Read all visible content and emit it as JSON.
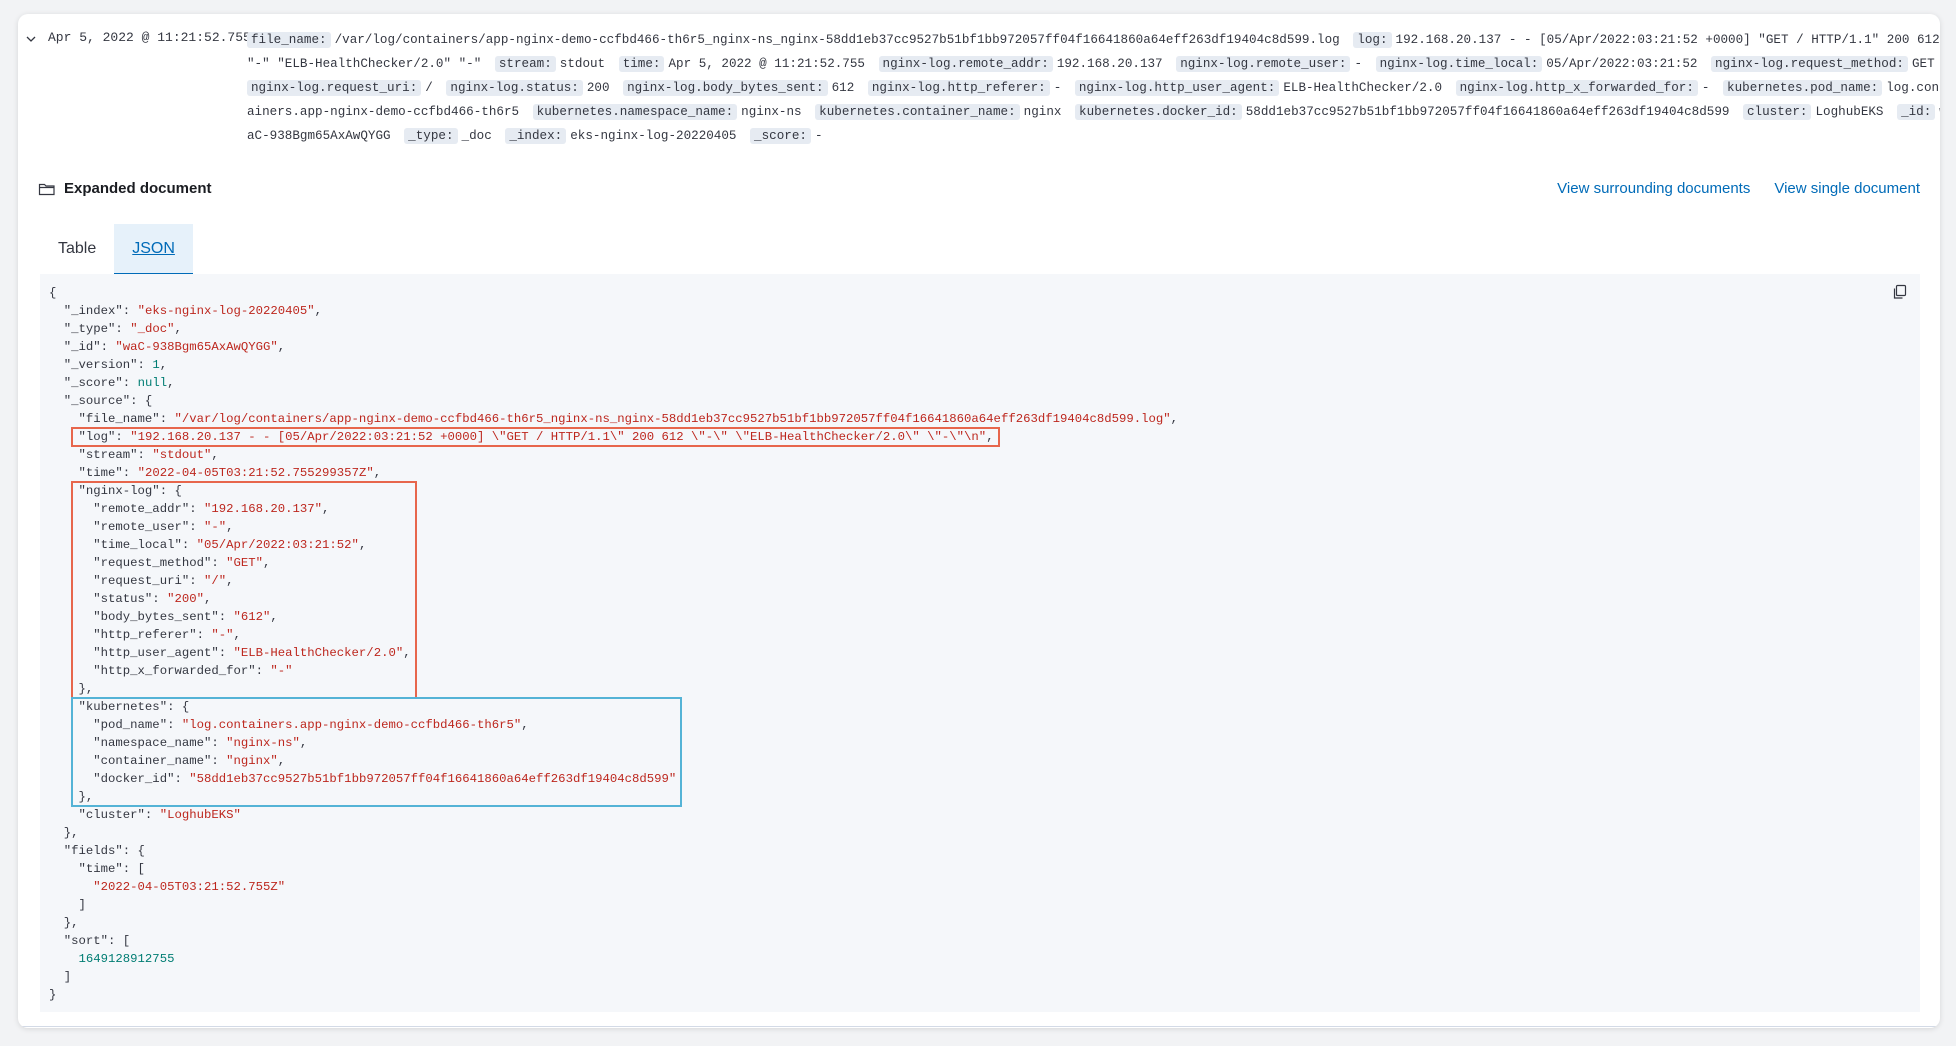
{
  "row": {
    "timestamp": "Apr 5, 2022 @ 11:21:52.755",
    "fields": [
      {
        "name": "file_name:",
        "value": "/var/log/containers/app-nginx-demo-ccfbd466-th6r5_nginx-ns_nginx-58dd1eb37cc9527b51bf1bb972057ff04f16641860a64eff263df19404c8d599.log"
      },
      {
        "name": "log:",
        "value": "192.168.20.137 - - [05/Apr/2022:03:21:52 +0000] \"GET / HTTP/1.1\" 200 612 \"-\" \"ELB-HealthChecker/2.0\" \"-\""
      },
      {
        "name": "stream:",
        "value": "stdout"
      },
      {
        "name": "time:",
        "value": "Apr 5, 2022 @ 11:21:52.755"
      },
      {
        "name": "nginx-log.remote_addr:",
        "value": "192.168.20.137"
      },
      {
        "name": "nginx-log.remote_user:",
        "value": "-"
      },
      {
        "name": "nginx-log.time_local:",
        "value": "05/Apr/2022:03:21:52"
      },
      {
        "name": "nginx-log.request_method:",
        "value": "GET"
      },
      {
        "name": "nginx-log.request_uri:",
        "value": "/"
      },
      {
        "name": "nginx-log.status:",
        "value": "200"
      },
      {
        "name": "nginx-log.body_bytes_sent:",
        "value": "612"
      },
      {
        "name": "nginx-log.http_referer:",
        "value": "-"
      },
      {
        "name": "nginx-log.http_user_agent:",
        "value": "ELB-HealthChecker/2.0"
      },
      {
        "name": "nginx-log.http_x_forwarded_for:",
        "value": "-"
      },
      {
        "name": "kubernetes.pod_name:",
        "value": "log.containers.app-nginx-demo-ccfbd466-th6r5"
      },
      {
        "name": "kubernetes.namespace_name:",
        "value": "nginx-ns"
      },
      {
        "name": "kubernetes.container_name:",
        "value": "nginx"
      },
      {
        "name": "kubernetes.docker_id:",
        "value": "58dd1eb37cc9527b51bf1bb972057ff04f16641860a64eff263df19404c8d599"
      },
      {
        "name": "cluster:",
        "value": "LoghubEKS"
      },
      {
        "name": "_id:",
        "value": "waC-938Bgm65AxAwQYGG"
      },
      {
        "name": "_type:",
        "value": "_doc"
      },
      {
        "name": "_index:",
        "value": "eks-nginx-log-20220405"
      },
      {
        "name": "_score:",
        "value": "-"
      }
    ]
  },
  "expanded": {
    "title": "Expanded document",
    "view_surrounding": "View surrounding documents",
    "view_single": "View single document",
    "tabs": [
      "Table",
      "JSON"
    ],
    "active_tab": "JSON"
  },
  "json_lines": [
    [
      [
        "p",
        "{"
      ]
    ],
    [
      [
        "k",
        "  \"_index\": "
      ],
      [
        "s",
        "\"eks-nginx-log-20220405\""
      ],
      [
        "p",
        ","
      ]
    ],
    [
      [
        "k",
        "  \"_type\": "
      ],
      [
        "s",
        "\"_doc\""
      ],
      [
        "p",
        ","
      ]
    ],
    [
      [
        "k",
        "  \"_id\": "
      ],
      [
        "s",
        "\"waC-938Bgm65AxAwQYGG\""
      ],
      [
        "p",
        ","
      ]
    ],
    [
      [
        "k",
        "  \"_version\": "
      ],
      [
        "n",
        "1"
      ],
      [
        "p",
        ","
      ]
    ],
    [
      [
        "k",
        "  \"_score\": "
      ],
      [
        "n",
        "null"
      ],
      [
        "p",
        ","
      ]
    ],
    [
      [
        "k",
        "  \"_source\": {"
      ]
    ],
    [
      [
        "k",
        "    \"file_name\": "
      ],
      [
        "s",
        "\"/var/log/containers/app-nginx-demo-ccfbd466-th6r5_nginx-ns_nginx-58dd1eb37cc9527b51bf1bb972057ff04f16641860a64eff263df19404c8d599.log\""
      ],
      [
        "p",
        ","
      ]
    ],
    [
      [
        "k",
        "    \"log\": "
      ],
      [
        "s",
        "\"192.168.20.137 - - [05/Apr/2022:03:21:52 +0000] \\\"GET / HTTP/1.1\\\" 200 612 \\\"-\\\" \\\"ELB-HealthChecker/2.0\\\" \\\"-\\\"\\n\""
      ],
      [
        "p",
        ","
      ]
    ],
    [
      [
        "k",
        "    \"stream\": "
      ],
      [
        "s",
        "\"stdout\""
      ],
      [
        "p",
        ","
      ]
    ],
    [
      [
        "k",
        "    \"time\": "
      ],
      [
        "s",
        "\"2022-04-05T03:21:52.755299357Z\""
      ],
      [
        "p",
        ","
      ]
    ],
    [
      [
        "k",
        "    \"nginx-log\": {"
      ]
    ],
    [
      [
        "k",
        "      \"remote_addr\": "
      ],
      [
        "s",
        "\"192.168.20.137\""
      ],
      [
        "p",
        ","
      ]
    ],
    [
      [
        "k",
        "      \"remote_user\": "
      ],
      [
        "s",
        "\"-\""
      ],
      [
        "p",
        ","
      ]
    ],
    [
      [
        "k",
        "      \"time_local\": "
      ],
      [
        "s",
        "\"05/Apr/2022:03:21:52\""
      ],
      [
        "p",
        ","
      ]
    ],
    [
      [
        "k",
        "      \"request_method\": "
      ],
      [
        "s",
        "\"GET\""
      ],
      [
        "p",
        ","
      ]
    ],
    [
      [
        "k",
        "      \"request_uri\": "
      ],
      [
        "s",
        "\"/\""
      ],
      [
        "p",
        ","
      ]
    ],
    [
      [
        "k",
        "      \"status\": "
      ],
      [
        "s",
        "\"200\""
      ],
      [
        "p",
        ","
      ]
    ],
    [
      [
        "k",
        "      \"body_bytes_sent\": "
      ],
      [
        "s",
        "\"612\""
      ],
      [
        "p",
        ","
      ]
    ],
    [
      [
        "k",
        "      \"http_referer\": "
      ],
      [
        "s",
        "\"-\""
      ],
      [
        "p",
        ","
      ]
    ],
    [
      [
        "k",
        "      \"http_user_agent\": "
      ],
      [
        "s",
        "\"ELB-HealthChecker/2.0\""
      ],
      [
        "p",
        ","
      ]
    ],
    [
      [
        "k",
        "      \"http_x_forwarded_for\": "
      ],
      [
        "s",
        "\"-\""
      ]
    ],
    [
      [
        "k",
        "    },"
      ]
    ],
    [
      [
        "k",
        "    \"kubernetes\": {"
      ]
    ],
    [
      [
        "k",
        "      \"pod_name\": "
      ],
      [
        "s",
        "\"log.containers.app-nginx-demo-ccfbd466-th6r5\""
      ],
      [
        "p",
        ","
      ]
    ],
    [
      [
        "k",
        "      \"namespace_name\": "
      ],
      [
        "s",
        "\"nginx-ns\""
      ],
      [
        "p",
        ","
      ]
    ],
    [
      [
        "k",
        "      \"container_name\": "
      ],
      [
        "s",
        "\"nginx\""
      ],
      [
        "p",
        ","
      ]
    ],
    [
      [
        "k",
        "      \"docker_id\": "
      ],
      [
        "s",
        "\"58dd1eb37cc9527b51bf1bb972057ff04f16641860a64eff263df19404c8d599\""
      ]
    ],
    [
      [
        "k",
        "    },"
      ]
    ],
    [
      [
        "k",
        "    \"cluster\": "
      ],
      [
        "s",
        "\"LoghubEKS\""
      ]
    ],
    [
      [
        "k",
        "  },"
      ]
    ],
    [
      [
        "k",
        "  \"fields\": {"
      ]
    ],
    [
      [
        "k",
        "    \"time\": ["
      ]
    ],
    [
      [
        "s",
        "      \"2022-04-05T03:21:52.755Z\""
      ]
    ],
    [
      [
        "k",
        "    ]"
      ]
    ],
    [
      [
        "k",
        "  },"
      ]
    ],
    [
      [
        "k",
        "  \"sort\": ["
      ]
    ],
    [
      [
        "n",
        "    1649128912755"
      ]
    ],
    [
      [
        "k",
        "  ]"
      ]
    ],
    [
      [
        "p",
        "}"
      ]
    ]
  ],
  "highlights": [
    {
      "color": "red",
      "from_line": 8,
      "to_line": 8
    },
    {
      "color": "red",
      "from_line": 11,
      "to_line": 22
    },
    {
      "color": "blue",
      "from_line": 23,
      "to_line": 28
    }
  ]
}
